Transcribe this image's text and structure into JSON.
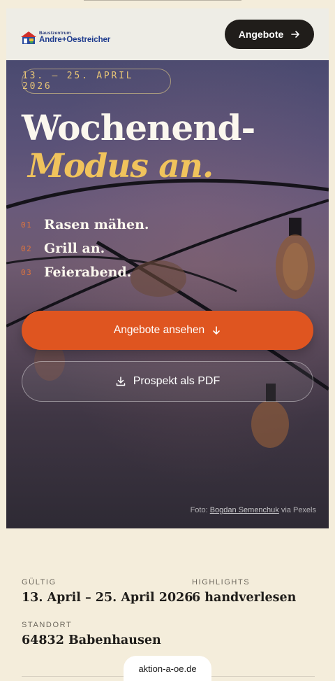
{
  "brand": {
    "small": "Baustzentrum",
    "name": "Andre+Oestreicher"
  },
  "header": {
    "cta_label": "Angebote"
  },
  "hero": {
    "date_range": "13. – 25. APRIL 2026",
    "title_line1": "Wochenend-",
    "title_line2": "Modus an.",
    "list": [
      {
        "num": "01",
        "text": "Rasen mähen."
      },
      {
        "num": "02",
        "text": "Grill an."
      },
      {
        "num": "03",
        "text": "Feierabend."
      }
    ],
    "primary_button": "Angebote ansehen",
    "secondary_button": "Prospekt als PDF",
    "credit_prefix": "Foto:",
    "credit_author": "Bogdan Semenchuk",
    "credit_suffix": "via Pexels"
  },
  "info": {
    "valid_label": "GÜLTIG",
    "valid_value": "13. April – 25. April 2026",
    "highlights_label": "HIGHLIGHTS",
    "highlights_value": "6 handverlesen",
    "location_label": "STANDORT",
    "location_value": "64832 Babenhausen"
  },
  "footer": {
    "domain": "aktion-a-oe.de"
  },
  "colors": {
    "accent_orange": "#df5520",
    "title_yellow": "#f0c35c",
    "page_bg": "#f4eddb",
    "dark_button": "#201d1a"
  },
  "icons": {
    "header_cta": "arrow-right-icon",
    "primary": "arrow-down-icon",
    "secondary": "download-icon"
  }
}
